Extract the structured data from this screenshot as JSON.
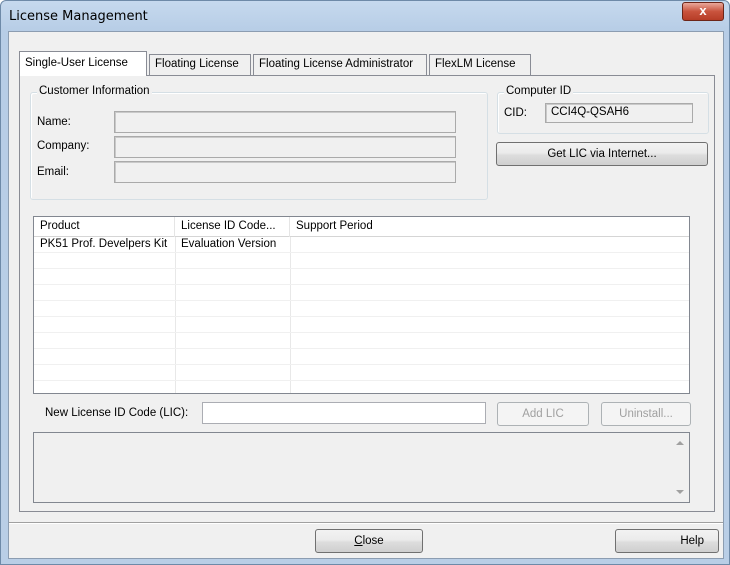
{
  "window": {
    "title": "License Management",
    "close_glyph": "x"
  },
  "tabs": [
    {
      "label": "Single-User License",
      "active": true
    },
    {
      "label": "Floating License",
      "active": false
    },
    {
      "label": "Floating License Administrator",
      "active": false
    },
    {
      "label": "FlexLM License",
      "active": false
    }
  ],
  "customer": {
    "legend": "Customer Information",
    "name_label": "Name:",
    "name_value": "",
    "company_label": "Company:",
    "company_value": "",
    "email_label": "Email:",
    "email_value": ""
  },
  "computer": {
    "legend": "Computer ID",
    "cid_label": "CID:",
    "cid_value": "CCI4Q-QSAH6",
    "get_lic_button": "Get LIC via Internet..."
  },
  "table": {
    "columns": [
      "Product",
      "License ID Code...",
      "Support Period"
    ],
    "rows": [
      {
        "product": "PK51 Prof. Develpers Kit",
        "license_code": "Evaluation Version",
        "support_period": ""
      }
    ]
  },
  "lic_entry": {
    "label": "New License ID Code (LIC):",
    "value": "",
    "add_button": "Add LIC",
    "uninstall_button": "Uninstall..."
  },
  "footer": {
    "close_button": "Close",
    "close_accel": "C",
    "close_rest": "lose",
    "help_button": "Help"
  },
  "icons": {
    "scroll_up": "scroll-up-icon",
    "scroll_down": "scroll-down-icon"
  }
}
